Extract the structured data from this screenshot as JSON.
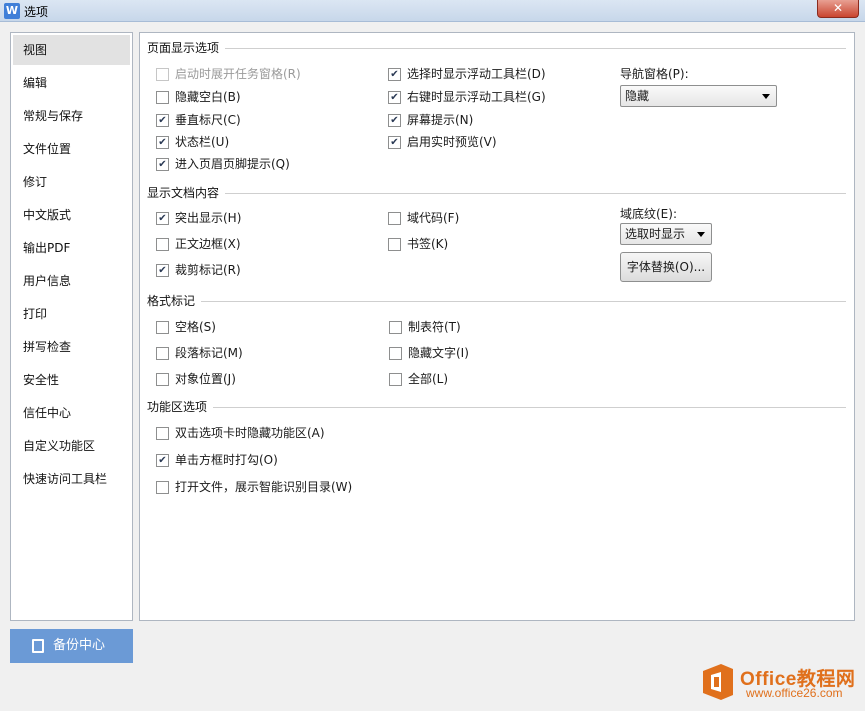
{
  "window": {
    "title": "选项",
    "app_icon": "W",
    "close_symbol": "✕"
  },
  "nav": {
    "items": [
      {
        "label": "视图",
        "selected": true
      },
      {
        "label": "编辑"
      },
      {
        "label": "常规与保存"
      },
      {
        "label": "文件位置"
      },
      {
        "label": "修订"
      },
      {
        "label": "中文版式"
      },
      {
        "label": "输出PDF"
      },
      {
        "label": "用户信息"
      },
      {
        "label": "打印"
      },
      {
        "label": "拼写检查"
      },
      {
        "label": "安全性"
      },
      {
        "label": "信任中心"
      },
      {
        "label": "自定义功能区"
      },
      {
        "label": "快速访问工具栏"
      }
    ],
    "backup_button": "备份中心"
  },
  "sections": {
    "page_display": {
      "title": "页面显示选项",
      "options": [
        {
          "label": "启动时展开任务窗格(R)",
          "checked": false,
          "disabled": true
        },
        {
          "label": "隐藏空白(B)",
          "checked": false
        },
        {
          "label": "垂直标尺(C)",
          "checked": true
        },
        {
          "label": "状态栏(U)",
          "checked": true
        },
        {
          "label": "进入页眉页脚提示(Q)",
          "checked": true
        },
        {
          "label": "选择时显示浮动工具栏(D)",
          "checked": true
        },
        {
          "label": "右键时显示浮动工具栏(G)",
          "checked": true
        },
        {
          "label": "屏幕提示(N)",
          "checked": true
        },
        {
          "label": "启用实时预览(V)",
          "checked": true
        }
      ],
      "nav_pane_label": "导航窗格(P):",
      "nav_pane_value": "隐藏"
    },
    "doc_content": {
      "title": "显示文档内容",
      "options": [
        {
          "label": "突出显示(H)",
          "checked": true
        },
        {
          "label": "正文边框(X)",
          "checked": false
        },
        {
          "label": "裁剪标记(R)",
          "checked": true
        },
        {
          "label": "域代码(F)",
          "checked": false
        },
        {
          "label": "书签(K)",
          "checked": false
        }
      ],
      "field_shading_label": "域底纹(E):",
      "field_shading_value": "选取时显示",
      "font_replace_button": "字体替换(O)..."
    },
    "format_marks": {
      "title": "格式标记",
      "options": [
        {
          "label": "空格(S)",
          "checked": false
        },
        {
          "label": "段落标记(M)",
          "checked": false
        },
        {
          "label": "对象位置(J)",
          "checked": false
        },
        {
          "label": "制表符(T)",
          "checked": false
        },
        {
          "label": "隐藏文字(I)",
          "checked": false
        },
        {
          "label": "全部(L)",
          "checked": false
        }
      ]
    },
    "ribbon": {
      "title": "功能区选项",
      "options": [
        {
          "label": "双击选项卡时隐藏功能区(A)",
          "checked": false
        },
        {
          "label": "单击方框时打勾(O)",
          "checked": true
        },
        {
          "label": "打开文件，展示智能识别目录(W)",
          "checked": false
        }
      ]
    }
  },
  "watermark": {
    "brand": "Office教程网",
    "url": "www.office26.com",
    "logo_color": "#e0701c"
  },
  "colors": {
    "backup_bg": "#6b9ad6",
    "selected_nav_bg": "#e2e2e2"
  }
}
